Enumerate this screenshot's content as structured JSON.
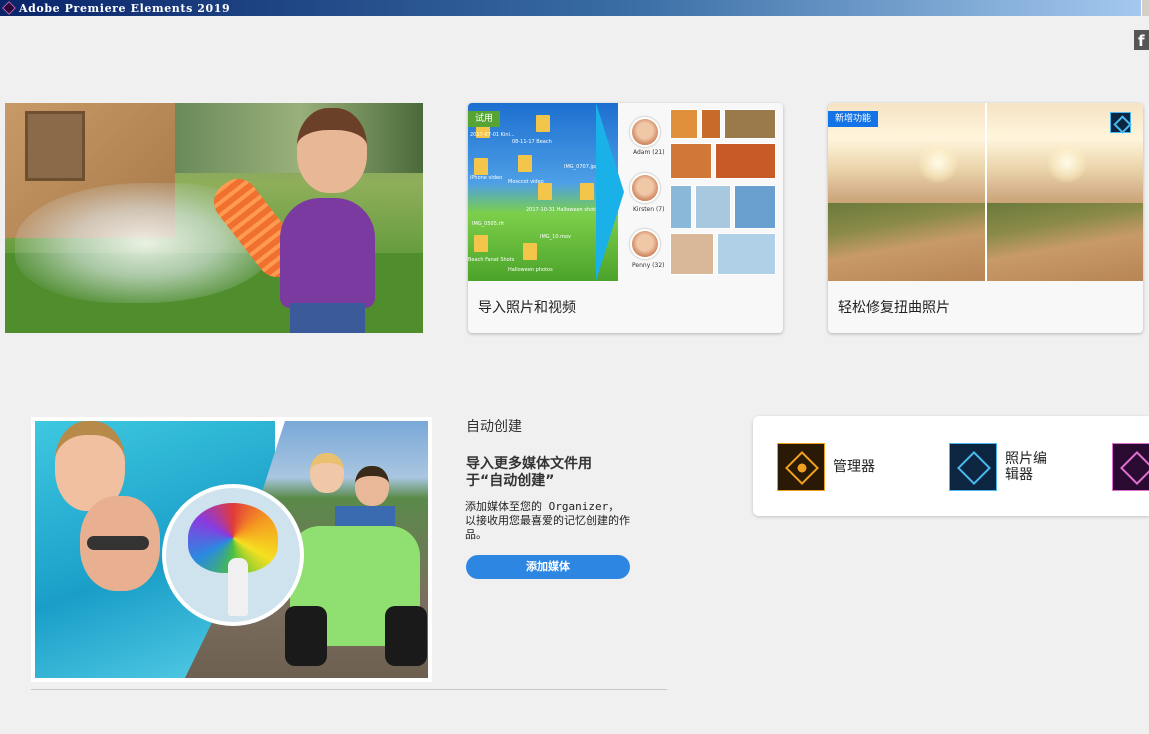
{
  "window": {
    "title": "Adobe Premiere Elements 2019"
  },
  "social": {
    "facebook_glyph": "f"
  },
  "cards": [
    {
      "badge": "试用",
      "badge_color": "#56a534",
      "caption": "导入照片和视频",
      "illustration": {
        "files": [
          "2017-07-01 Kinl...",
          "08-11-17 Beach",
          "IMG_0707.jpg",
          "iPhone video",
          "Mosccot video",
          "2017-10-31 Halloween shots 2004...",
          "IMG_0505.rfr",
          "IMG_10.mov",
          "Beach Fanat Shots",
          "Halloween photos"
        ],
        "people": [
          {
            "name": "Adam (21)"
          },
          {
            "name": "Kirsten (7)"
          },
          {
            "name": "Penny (32)"
          }
        ]
      }
    },
    {
      "badge": "新增功能",
      "badge_color": "#1473e6",
      "caption": "轻松修复扭曲照片"
    }
  ],
  "auto_create": {
    "label": "自动创建",
    "heading": "导入更多媒体文件用于“自动创建”",
    "description": "添加媒体至您的 Organizer，以接收用您最喜爱的记忆创建的作品。",
    "button": "添加媒体",
    "button_color": "#2d86e1"
  },
  "apps": [
    {
      "label": "管理器",
      "icon": "organizer-icon"
    },
    {
      "label": "照片编辑器",
      "icon": "photoshop-elements-icon"
    },
    {
      "label": "",
      "icon": "premiere-elements-icon"
    }
  ]
}
